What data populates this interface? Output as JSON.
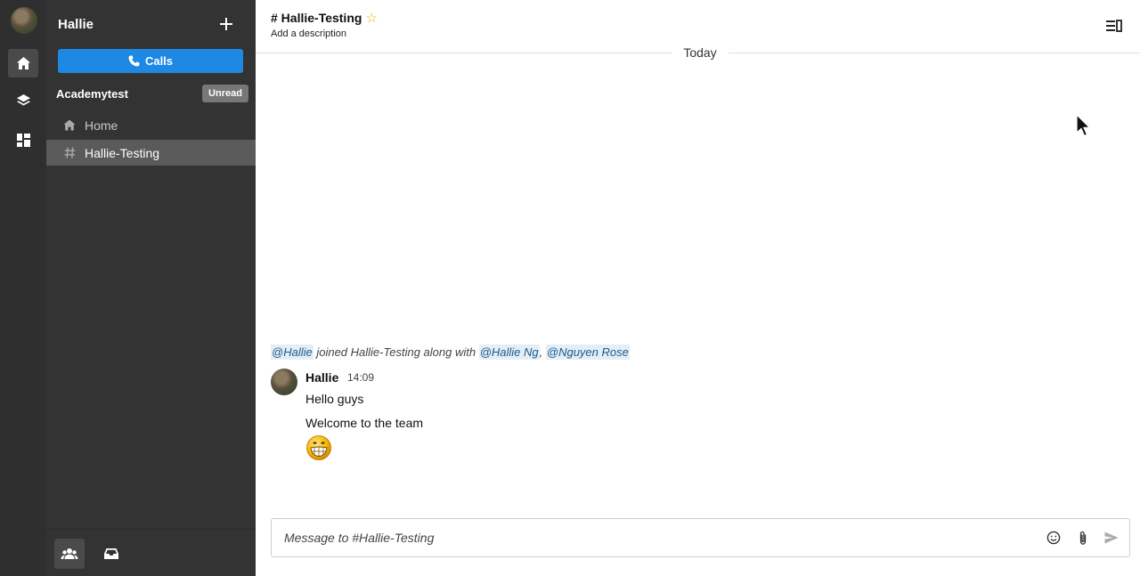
{
  "rail": {
    "items": [
      {
        "name": "home"
      },
      {
        "name": "layers"
      },
      {
        "name": "directory"
      }
    ]
  },
  "sidebar": {
    "username": "Hallie",
    "calls_label": "Calls",
    "team_name": "Academytest",
    "unread_label": "Unread",
    "nav": {
      "home_label": "Home",
      "channel_label": "Hallie-Testing"
    }
  },
  "header": {
    "channel_title": "# Hallie-Testing",
    "description": "Add a description"
  },
  "feed": {
    "date_divider": "Today",
    "system_message": {
      "mention1": "@Hallie",
      "text": " joined Hallie-Testing along with ",
      "mention2": "@Hallie Ng",
      "separator": ", ",
      "mention3": "@Nguyen Rose"
    },
    "message": {
      "author": "Hallie",
      "time": "14:09",
      "line1": "Hello guys",
      "line2": "Welcome to the team",
      "emoji": "grinning-face"
    }
  },
  "composer": {
    "placeholder": "Message to #Hallie-Testing"
  },
  "colors": {
    "rail_bg": "#2f2f2f",
    "sidebar_bg": "#333333",
    "accent_blue": "#1e88e5",
    "active_item_bg": "#5a5a5a",
    "star": "#f2b400"
  }
}
